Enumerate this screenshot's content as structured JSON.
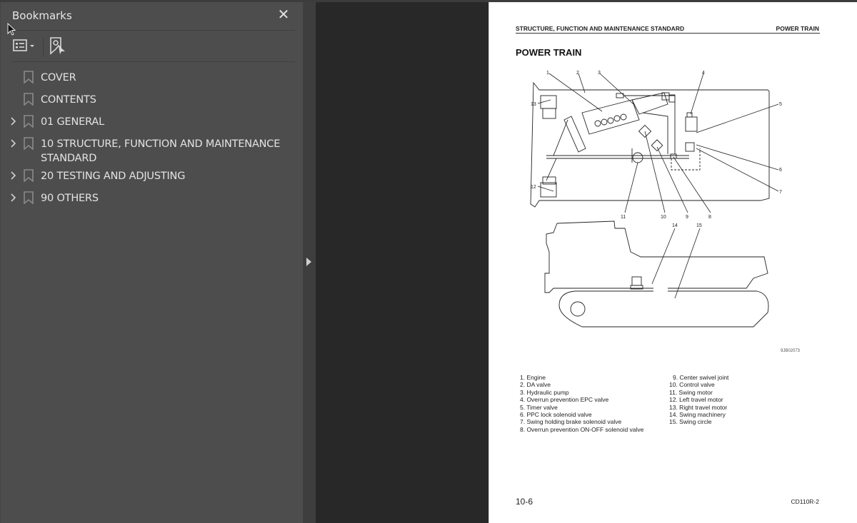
{
  "bookmarks_panel": {
    "title": "Bookmarks",
    "close_label": "✕",
    "items": [
      {
        "label": "COVER",
        "expandable": false
      },
      {
        "label": "CONTENTS",
        "expandable": false
      },
      {
        "label": "01 GENERAL",
        "expandable": true
      },
      {
        "label": "10 STRUCTURE, FUNCTION AND MAINTENANCE STANDARD",
        "expandable": true
      },
      {
        "label": "20 TESTING AND ADJUSTING",
        "expandable": true
      },
      {
        "label": "90 OTHERS",
        "expandable": true
      }
    ]
  },
  "page": {
    "header_left": "STRUCTURE, FUNCTION AND MAINTENANCE STANDARD",
    "header_right": "POWER TRAIN",
    "title": "POWER TRAIN",
    "figure_id": "9JB02073",
    "callouts": [
      "1",
      "2",
      "3",
      "4",
      "5",
      "6",
      "7",
      "8",
      "9",
      "10",
      "11",
      "12",
      "13",
      "14",
      "15"
    ],
    "legend_left": [
      "1. Engine",
      "2. DA valve",
      "3. Hydraulic pump",
      "4. Overrun prevention EPC valve",
      "5. Timer valve",
      "6. PPC lock solenoid valve",
      "7. Swing holding brake solenoid valve",
      "8. Overrun prevention ON-OFF solenoid valve"
    ],
    "legend_right": [
      "9. Center swivel joint",
      "10. Control valve",
      "11. Swing motor",
      "12. Left travel motor",
      "13. Right travel motor",
      "14. Swing machinery",
      "15. Swing circle"
    ],
    "page_number": "10-6",
    "model": "CD110R-2"
  }
}
